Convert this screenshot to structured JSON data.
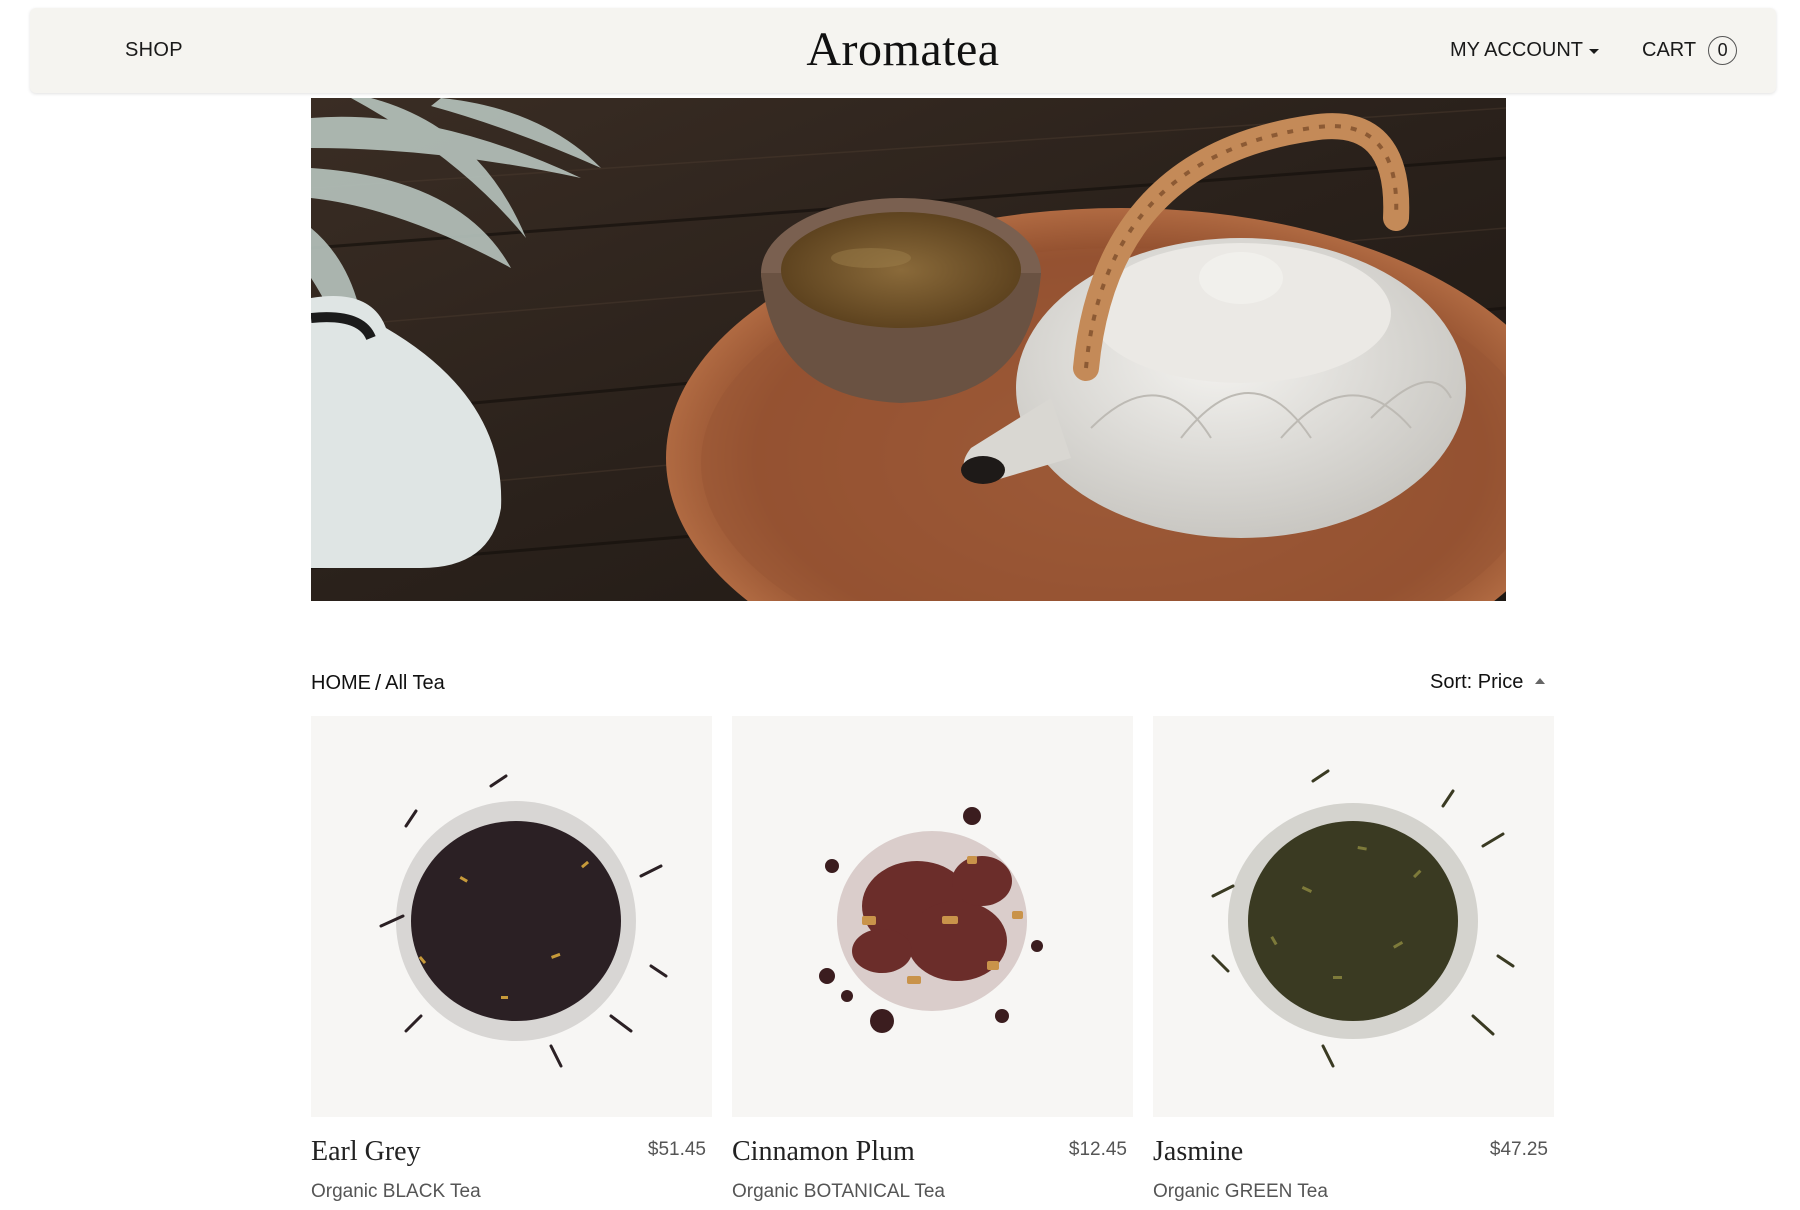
{
  "header": {
    "shop_label": "SHOP",
    "brand": "Aromatea",
    "account_label": "MY ACCOUNT",
    "cart_label": "CART",
    "cart_count": "0"
  },
  "hero": {
    "image": "teapot-and-cup-on-wooden-tray"
  },
  "toolbar": {
    "breadcrumb_home": "HOME",
    "breadcrumb_separator": "/",
    "breadcrumb_current": "All Tea",
    "sort_label": "Sort: Price"
  },
  "products": [
    {
      "name": "Earl Grey",
      "price": "$51.45",
      "subtitle": "Organic BLACK Tea",
      "image": "black-tea-leaves",
      "color": "#2b2024"
    },
    {
      "name": "Cinnamon Plum",
      "price": "$12.45",
      "subtitle": "Organic BOTANICAL Tea",
      "image": "botanical-tea-blend",
      "color": "#6b2d2a"
    },
    {
      "name": "Jasmine",
      "price": "$47.25",
      "subtitle": "Organic GREEN Tea",
      "image": "green-tea-leaves",
      "color": "#3a3a22"
    }
  ],
  "colors": {
    "header_bg": "#f5f4f0",
    "product_bg": "#f7f6f4",
    "text": "#1a1a1a",
    "muted": "#555555"
  }
}
